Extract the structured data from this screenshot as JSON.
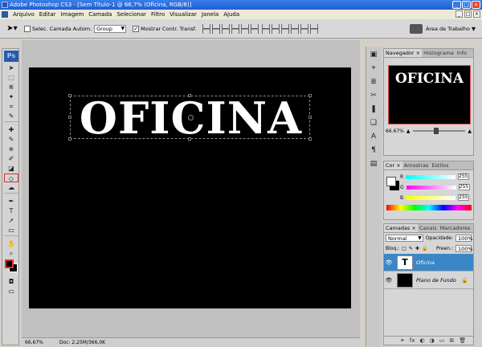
{
  "window": {
    "title": "Adobe Photoshop CS3 - [Sem Título-1 @ 66,7% (Oficina, RGB/8)]",
    "buttons": [
      "_",
      "□",
      "×"
    ]
  },
  "menu": {
    "items": [
      "Arquivo",
      "Editar",
      "Imagem",
      "Camada",
      "Selecionar",
      "Filtro",
      "Visualizar",
      "Janela",
      "Ajuda"
    ],
    "doc_controls": [
      "_",
      "□",
      "×"
    ]
  },
  "options": {
    "auto_select_label": "Selec. Camada Autom.",
    "auto_select_value": "Group",
    "show_transform_label": "Mostrar Contr. Transf.",
    "workspace_label": "Área de Trabalho ▼"
  },
  "document": {
    "text": "OFICINA",
    "zoom": "66,67%",
    "doc_info": "Doc: 2,25M/366,0K"
  },
  "toolbox": {
    "logo": "Ps",
    "tools": [
      "➤",
      "⬚",
      "ᓬ",
      "✦",
      "⌗",
      "✎",
      "✚",
      "✎",
      "⎈",
      "✐",
      "◪",
      "◇",
      "☁",
      "✒",
      "T",
      "➚",
      "▭",
      "✋",
      "⌕"
    ]
  },
  "navigator": {
    "tabs": [
      "Navegador ×",
      "Histograma",
      "Info"
    ],
    "preview_text": "OFICINA",
    "zoom": "66.67%"
  },
  "color": {
    "tabs": [
      "Cor ×",
      "Amostras",
      "Estilos"
    ],
    "channels": [
      {
        "label": "R",
        "value": "255"
      },
      {
        "label": "G",
        "value": "255"
      },
      {
        "label": "B",
        "value": "255"
      }
    ]
  },
  "layers": {
    "tabs": [
      "Camadas ×",
      "Canais",
      "Marcadores"
    ],
    "blend_mode": "Normal",
    "opacity_label": "Opacidade:",
    "opacity": "100%",
    "lock_label": "Bloq.:",
    "fill_label": "Preen.:",
    "fill": "100%",
    "items": [
      {
        "name": "Oficina",
        "thumb": "T"
      },
      {
        "name": "Plano de Fundo",
        "thumb": ""
      }
    ],
    "footer_icons": [
      "⚭",
      "fx",
      "◐",
      "◑",
      "▭",
      "⊞",
      "🗑"
    ]
  },
  "dock": {
    "icons": [
      "▣",
      "⌖",
      "≣",
      "✂",
      "❚",
      "❏",
      "A",
      "¶",
      "▤"
    ]
  },
  "colors": {
    "titlebar": "#1f5fd6",
    "selected_layer": "#3b86c6",
    "canvas": "#000000",
    "text": "#ffffff"
  }
}
